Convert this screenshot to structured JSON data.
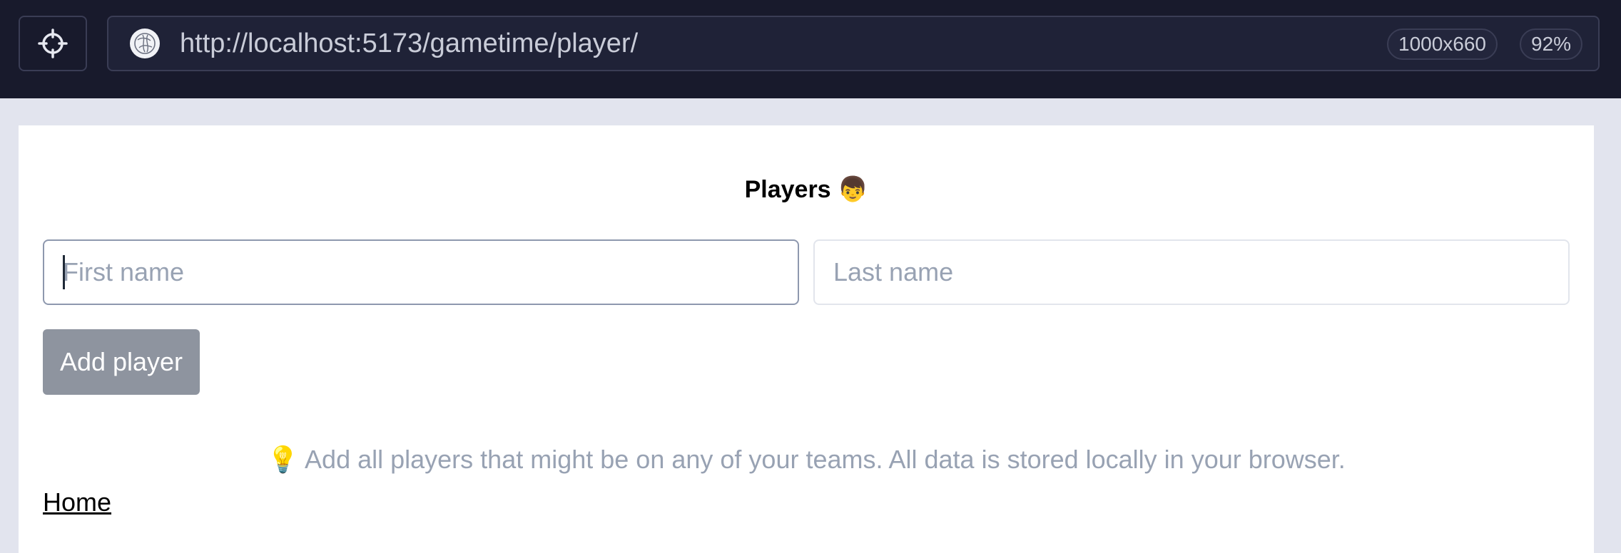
{
  "browser": {
    "url": "http://localhost:5173/gametime/player/",
    "viewport_size": "1000x660",
    "zoom": "92%",
    "target_icon": "crosshair-icon",
    "site_icon": "globe-icon"
  },
  "page": {
    "title": "Players",
    "title_emoji": "👦",
    "first_name_placeholder": "First name",
    "last_name_placeholder": "Last name",
    "add_button_label": "Add player",
    "hint_emoji": "💡",
    "hint_text": "Add all players that might be on any of your teams. All data is stored locally in your browser.",
    "home_link": "Home"
  },
  "colors": {
    "toolbar_bg": "#181a2c",
    "page_bg": "#e2e4ee",
    "button_bg": "#8e949f",
    "hint_text": "#98a2b3"
  }
}
